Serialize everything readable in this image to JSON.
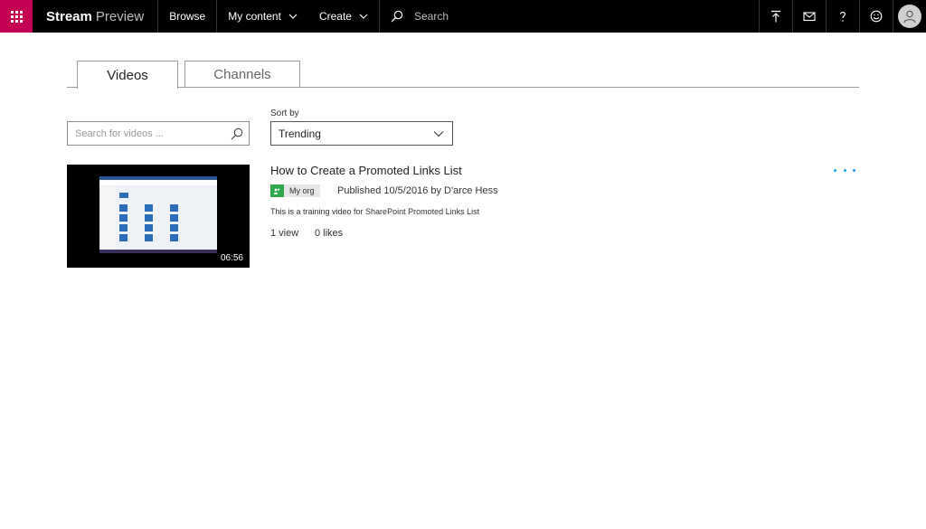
{
  "app": {
    "brand_name": "Stream",
    "brand_suffix": "Preview",
    "accent_color": "#c30052"
  },
  "nav": {
    "browse": "Browse",
    "my_content": "My content",
    "create": "Create"
  },
  "top_search": {
    "placeholder": "Search"
  },
  "top_icons": [
    "upload-icon",
    "mail-icon",
    "help-icon",
    "smiley-icon",
    "avatar"
  ],
  "tabs": {
    "videos": "Videos",
    "channels": "Channels",
    "active": "Videos"
  },
  "filters": {
    "search_placeholder": "Search for videos ...",
    "sort_label": "Sort by",
    "sort_value": "Trending"
  },
  "video": {
    "title": "How to Create a Promoted Links List",
    "duration": "06:56",
    "badge": "My org",
    "published": "Published 10/5/2016 by D'arce Hess",
    "description": "This is a training video for SharePoint Promoted Links List",
    "views": "1 view",
    "likes": "0 likes"
  }
}
